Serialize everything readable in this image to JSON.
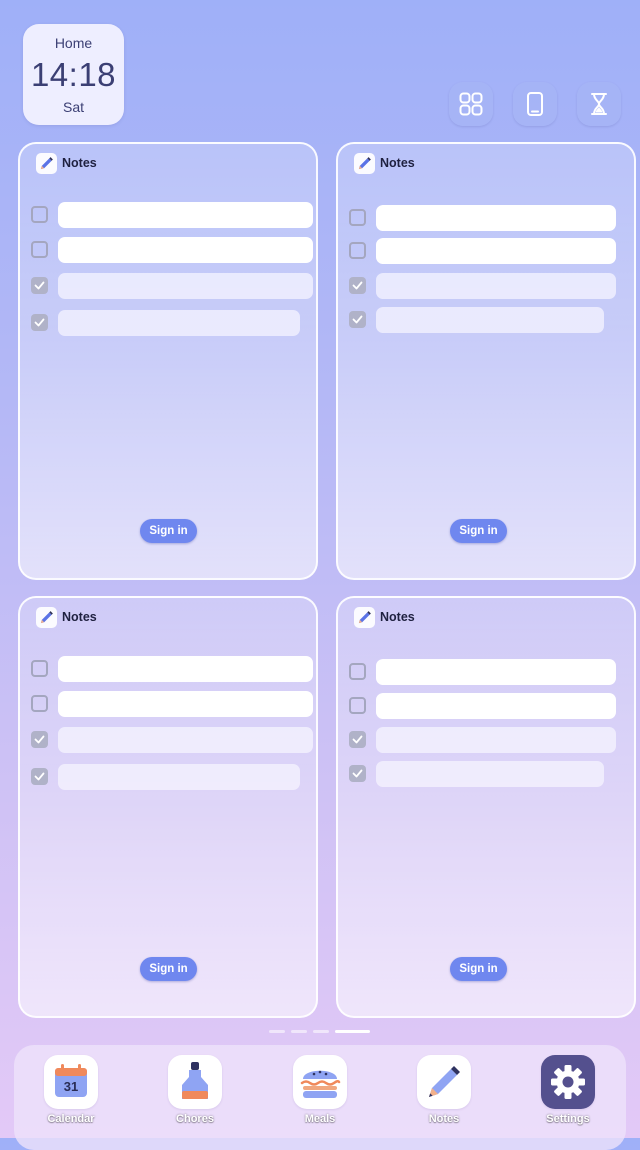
{
  "clock": {
    "label": "Home",
    "time": "14:18",
    "day": "Sat"
  },
  "top_actions": [
    {
      "icon": "grid-apps-icon"
    },
    {
      "icon": "phone-icon"
    },
    {
      "icon": "hourglass-icon"
    }
  ],
  "widgets": [
    {
      "title": "Notes",
      "sign_in_label": "Sign in",
      "items": [
        {
          "checked": false
        },
        {
          "checked": false
        },
        {
          "checked": true
        },
        {
          "checked": true
        }
      ]
    },
    {
      "title": "Notes",
      "sign_in_label": "Sign in",
      "items": [
        {
          "checked": false
        },
        {
          "checked": false
        },
        {
          "checked": true
        },
        {
          "checked": true
        }
      ]
    },
    {
      "title": "Notes",
      "sign_in_label": "Sign in",
      "items": [
        {
          "checked": false
        },
        {
          "checked": false
        },
        {
          "checked": true
        },
        {
          "checked": true
        }
      ]
    },
    {
      "title": "Notes",
      "sign_in_label": "Sign in",
      "items": [
        {
          "checked": false
        },
        {
          "checked": false
        },
        {
          "checked": true
        },
        {
          "checked": true
        }
      ]
    }
  ],
  "page_indicator": {
    "total": 4,
    "active_index": 3
  },
  "dock": {
    "apps": [
      {
        "label": "Calendar",
        "icon": "calendar-icon",
        "icon_text": "31"
      },
      {
        "label": "Chores",
        "icon": "spray-bottle-icon"
      },
      {
        "label": "Meals",
        "icon": "burger-icon"
      },
      {
        "label": "Notes",
        "icon": "pencil-icon"
      },
      {
        "label": "Settings",
        "icon": "gear-icon"
      }
    ]
  },
  "colors": {
    "accent": "#6f87ef",
    "settings_tile": "#54508e",
    "text_dark": "#1f2140"
  }
}
